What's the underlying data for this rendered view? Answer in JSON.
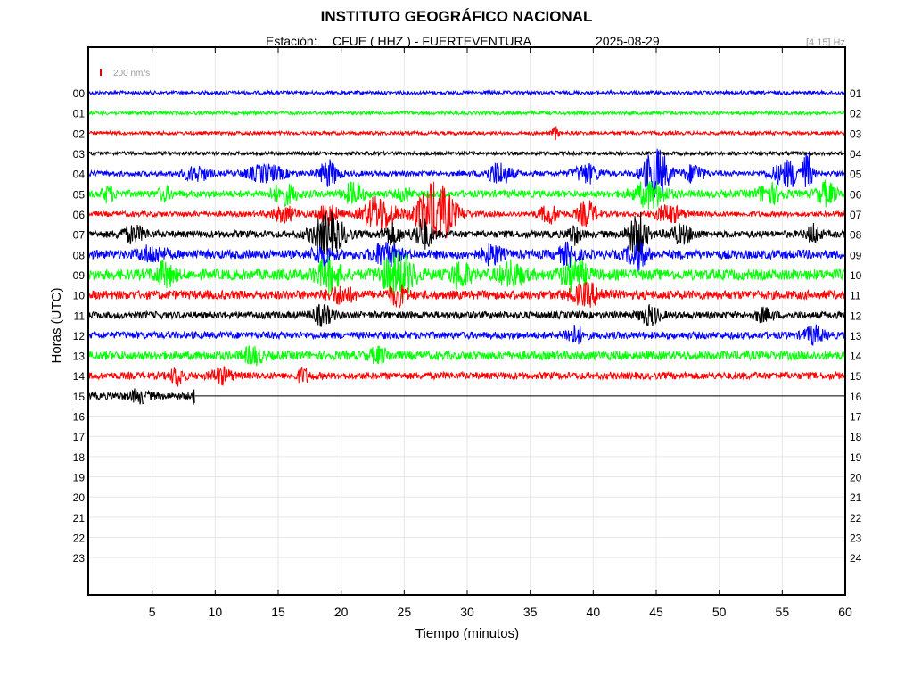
{
  "chart_data": {
    "type": "line",
    "title": "INSTITUTO GEOGRÁFICO NACIONAL",
    "subtitle": {
      "station_label": "Estación:",
      "station": "CFUE ( HHZ ) - FUERTEVENTURA",
      "date": "2025-08-29"
    },
    "filter_band": "[4 15] Hz",
    "scale_label": "200 nm/s",
    "scale_color": "#e00000",
    "xlabel": "Tiempo (minutos)",
    "ylabel": "Horas (UTC)",
    "xlim": [
      0,
      60
    ],
    "x_ticks": [
      "5",
      "10",
      "15",
      "20",
      "25",
      "30",
      "35",
      "40",
      "45",
      "50",
      "55",
      "60"
    ],
    "left_hour_labels": [
      "00",
      "01",
      "02",
      "03",
      "04",
      "05",
      "06",
      "07",
      "08",
      "09",
      "10",
      "11",
      "12",
      "13",
      "14",
      "15",
      "16",
      "17",
      "18",
      "19",
      "20",
      "21",
      "22",
      "23"
    ],
    "right_hour_labels": [
      "01",
      "02",
      "03",
      "04",
      "05",
      "06",
      "07",
      "08",
      "09",
      "10",
      "11",
      "12",
      "13",
      "14",
      "15",
      "16",
      "17",
      "18",
      "19",
      "20",
      "21",
      "22",
      "23",
      "24"
    ],
    "grid": true,
    "trace_colors": [
      "#0000ff",
      "#00ff00",
      "#ff0000",
      "#000000"
    ],
    "series": [
      {
        "hour": "00",
        "end_minute": 60,
        "base_amplitude": 2,
        "events": []
      },
      {
        "hour": "01",
        "end_minute": 60,
        "base_amplitude": 2,
        "events": []
      },
      {
        "hour": "02",
        "end_minute": 60,
        "base_amplitude": 2,
        "events": [
          {
            "t": 37.0,
            "amp": 7,
            "dur": 0.5
          }
        ]
      },
      {
        "hour": "03",
        "end_minute": 60,
        "base_amplitude": 2,
        "events": []
      },
      {
        "hour": "04",
        "end_minute": 60,
        "base_amplitude": 3,
        "events": [
          {
            "t": 8.5,
            "amp": 8,
            "dur": 2
          },
          {
            "t": 14,
            "amp": 9,
            "dur": 3
          },
          {
            "t": 19,
            "amp": 14,
            "dur": 1.5
          },
          {
            "t": 32.5,
            "amp": 12,
            "dur": 2
          },
          {
            "t": 39.5,
            "amp": 10,
            "dur": 2
          },
          {
            "t": 45,
            "amp": 28,
            "dur": 2
          },
          {
            "t": 48,
            "amp": 10,
            "dur": 1.5
          },
          {
            "t": 55.5,
            "amp": 14,
            "dur": 2.5
          },
          {
            "t": 57,
            "amp": 24,
            "dur": 0.6
          }
        ]
      },
      {
        "hour": "05",
        "end_minute": 60,
        "base_amplitude": 4,
        "events": [
          {
            "t": 1.5,
            "amp": 8,
            "dur": 1
          },
          {
            "t": 6,
            "amp": 7,
            "dur": 1
          },
          {
            "t": 15.5,
            "amp": 10,
            "dur": 2
          },
          {
            "t": 21,
            "amp": 12,
            "dur": 1.5
          },
          {
            "t": 25,
            "amp": 7,
            "dur": 1
          },
          {
            "t": 44.5,
            "amp": 14,
            "dur": 2.5
          },
          {
            "t": 54,
            "amp": 10,
            "dur": 2
          },
          {
            "t": 58.5,
            "amp": 12,
            "dur": 1.5
          }
        ]
      },
      {
        "hour": "06",
        "end_minute": 60,
        "base_amplitude": 3,
        "events": [
          {
            "t": 15.5,
            "amp": 8,
            "dur": 2
          },
          {
            "t": 19,
            "amp": 12,
            "dur": 1.5
          },
          {
            "t": 23,
            "amp": 20,
            "dur": 2.5
          },
          {
            "t": 27.5,
            "amp": 34,
            "dur": 3
          },
          {
            "t": 36.5,
            "amp": 10,
            "dur": 1.5
          },
          {
            "t": 39.5,
            "amp": 14,
            "dur": 1.5
          },
          {
            "t": 46,
            "amp": 10,
            "dur": 2
          }
        ]
      },
      {
        "hour": "07",
        "end_minute": 60,
        "base_amplitude": 4,
        "events": [
          {
            "t": 3.5,
            "amp": 8,
            "dur": 2
          },
          {
            "t": 19,
            "amp": 22,
            "dur": 2.5
          },
          {
            "t": 24,
            "amp": 10,
            "dur": 1.5
          },
          {
            "t": 26.5,
            "amp": 16,
            "dur": 1.5
          },
          {
            "t": 38.5,
            "amp": 10,
            "dur": 1
          },
          {
            "t": 43.5,
            "amp": 24,
            "dur": 1.5
          },
          {
            "t": 47,
            "amp": 9,
            "dur": 2
          },
          {
            "t": 57.5,
            "amp": 10,
            "dur": 1
          }
        ]
      },
      {
        "hour": "08",
        "end_minute": 60,
        "base_amplitude": 5,
        "events": [
          {
            "t": 5,
            "amp": 8,
            "dur": 2
          },
          {
            "t": 18.5,
            "amp": 10,
            "dur": 1.5
          },
          {
            "t": 23.5,
            "amp": 12,
            "dur": 2
          },
          {
            "t": 32,
            "amp": 10,
            "dur": 1.5
          },
          {
            "t": 38,
            "amp": 10,
            "dur": 1.5
          },
          {
            "t": 43.5,
            "amp": 14,
            "dur": 1.5
          }
        ]
      },
      {
        "hour": "09",
        "end_minute": 60,
        "base_amplitude": 6,
        "events": [
          {
            "t": 6,
            "amp": 12,
            "dur": 1.5
          },
          {
            "t": 19,
            "amp": 16,
            "dur": 2
          },
          {
            "t": 24.5,
            "amp": 24,
            "dur": 2.5
          },
          {
            "t": 29.5,
            "amp": 14,
            "dur": 1.5
          },
          {
            "t": 33.5,
            "amp": 12,
            "dur": 2
          },
          {
            "t": 38.5,
            "amp": 16,
            "dur": 2
          }
        ]
      },
      {
        "hour": "10",
        "end_minute": 60,
        "base_amplitude": 5,
        "events": [
          {
            "t": 20,
            "amp": 8,
            "dur": 2
          },
          {
            "t": 24.5,
            "amp": 10,
            "dur": 1.5
          },
          {
            "t": 39.5,
            "amp": 10,
            "dur": 2.5
          }
        ]
      },
      {
        "hour": "11",
        "end_minute": 60,
        "base_amplitude": 4,
        "events": [
          {
            "t": 18.5,
            "amp": 10,
            "dur": 1.5
          },
          {
            "t": 44.5,
            "amp": 10,
            "dur": 1.5
          },
          {
            "t": 53.5,
            "amp": 6,
            "dur": 1.5
          }
        ]
      },
      {
        "hour": "12",
        "end_minute": 60,
        "base_amplitude": 4,
        "events": [
          {
            "t": 38.5,
            "amp": 9,
            "dur": 1.5
          },
          {
            "t": 57.5,
            "amp": 9,
            "dur": 1.5
          }
        ]
      },
      {
        "hour": "13",
        "end_minute": 60,
        "base_amplitude": 5,
        "events": [
          {
            "t": 13,
            "amp": 8,
            "dur": 1.5
          },
          {
            "t": 23,
            "amp": 7,
            "dur": 1.5
          }
        ]
      },
      {
        "hour": "14",
        "end_minute": 60,
        "base_amplitude": 4,
        "events": [
          {
            "t": 7,
            "amp": 10,
            "dur": 1
          },
          {
            "t": 10.5,
            "amp": 8,
            "dur": 1.5
          },
          {
            "t": 17,
            "amp": 7,
            "dur": 1
          }
        ]
      },
      {
        "hour": "15",
        "end_minute": 8.4,
        "base_amplitude": 4,
        "events": [
          {
            "t": 4,
            "amp": 6,
            "dur": 1.5
          },
          {
            "t": 8.3,
            "amp": 9,
            "dur": 0.2
          }
        ]
      }
    ]
  }
}
